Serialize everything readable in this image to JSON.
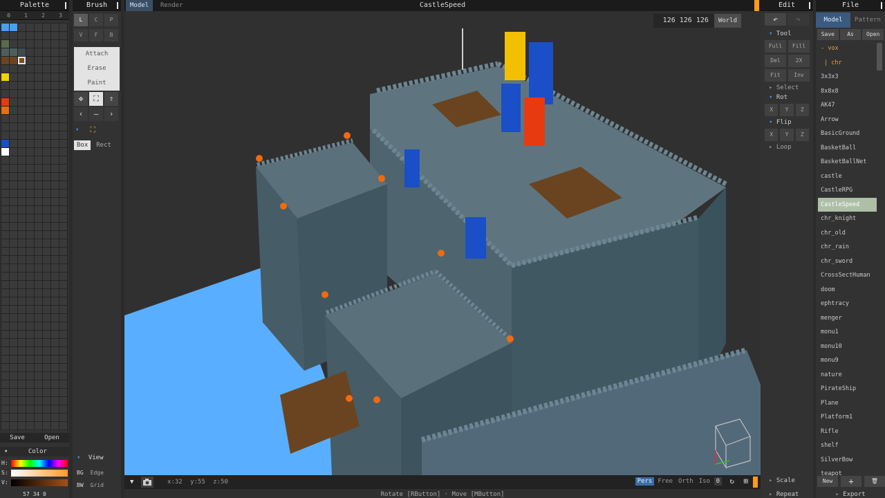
{
  "palette": {
    "title": "Palette",
    "tabs": [
      "0",
      "1",
      "2",
      "3"
    ],
    "swatches": [
      {
        "col": 0,
        "row": 0,
        "color": "#4a9ff0"
      },
      {
        "col": 1,
        "row": 0,
        "color": "#4a9ff0"
      },
      {
        "col": 0,
        "row": 2,
        "color": "#5c6a4c"
      },
      {
        "col": 0,
        "row": 3,
        "color": "#4d5e5e"
      },
      {
        "col": 1,
        "row": 3,
        "color": "#4d5e5e"
      },
      {
        "col": 2,
        "row": 3,
        "color": "#3f4c4f"
      },
      {
        "col": 0,
        "row": 4,
        "color": "#6a4420"
      },
      {
        "col": 1,
        "row": 4,
        "color": "#6a4420"
      },
      {
        "col": 2,
        "row": 4,
        "color": "#7a4f25",
        "selected": true
      },
      {
        "col": 0,
        "row": 6,
        "color": "#f2d200"
      },
      {
        "col": 0,
        "row": 9,
        "color": "#e83a10"
      },
      {
        "col": 0,
        "row": 10,
        "color": "#f06a10"
      },
      {
        "col": 0,
        "row": 14,
        "color": "#1a4fc8"
      },
      {
        "col": 0,
        "row": 15,
        "color": "#ffffff"
      }
    ],
    "save": "Save",
    "open": "Open",
    "color_label": "Color",
    "h_label": "H:",
    "s_label": "S:",
    "v_label": "V:",
    "readout": "57 34 0"
  },
  "brush": {
    "title": "Brush",
    "row1": [
      "L",
      "C",
      "P"
    ],
    "row2": [
      "V",
      "F",
      "B"
    ],
    "modes": [
      "Attach",
      "Erase",
      "Paint"
    ],
    "box": "Box",
    "rect": "Rect",
    "view_label": "View",
    "view_rows": [
      {
        "key": "BG",
        "val": "Edge"
      },
      {
        "key": "BW",
        "val": "Grid"
      }
    ]
  },
  "viewport": {
    "tabs": [
      "Model",
      "Render"
    ],
    "title": "CastleSpeed",
    "bg_coords": "126 126 126",
    "space": "World",
    "status": "x:32 y:55 z:50",
    "projections": [
      "Pers",
      "Free",
      "Orth",
      "Iso"
    ],
    "zero": "0",
    "hint": "Rotate [RButton] · Move [MButton]"
  },
  "edit": {
    "title": "Edit",
    "tool_label": "Tool",
    "tools": [
      "Full",
      "Fill",
      "Del",
      "2X",
      "Fit",
      "Inv"
    ],
    "select_label": "Select",
    "rot_label": "Rot",
    "flip_label": "Flip",
    "loop_label": "Loop",
    "axes": [
      "X",
      "Y",
      "Z"
    ],
    "scale_label": "Scale",
    "repeat_label": "Repeat"
  },
  "file": {
    "title": "File",
    "tabs": [
      "Model",
      "Pattern"
    ],
    "actions": [
      "Save",
      "As",
      "Open"
    ],
    "items": [
      "vox",
      "chr",
      "3x3x3",
      "8x8x8",
      "AK47",
      "Arrow",
      "BasicGround",
      "BasketBall",
      "BasketBallNet",
      "castle",
      "CastleRPG",
      "CastleSpeed",
      "chr_knight",
      "chr_old",
      "chr_rain",
      "chr_sword",
      "CrossSectHuman",
      "doom",
      "ephtracy",
      "menger",
      "monu1",
      "monu10",
      "monu9",
      "nature",
      "PirateShip",
      "Plane",
      "Platform1",
      "Rifle",
      "shelf",
      "SilverBow",
      "teapot"
    ],
    "active_item": "CastleSpeed",
    "new": "New",
    "plus": "+",
    "export": "Export"
  }
}
